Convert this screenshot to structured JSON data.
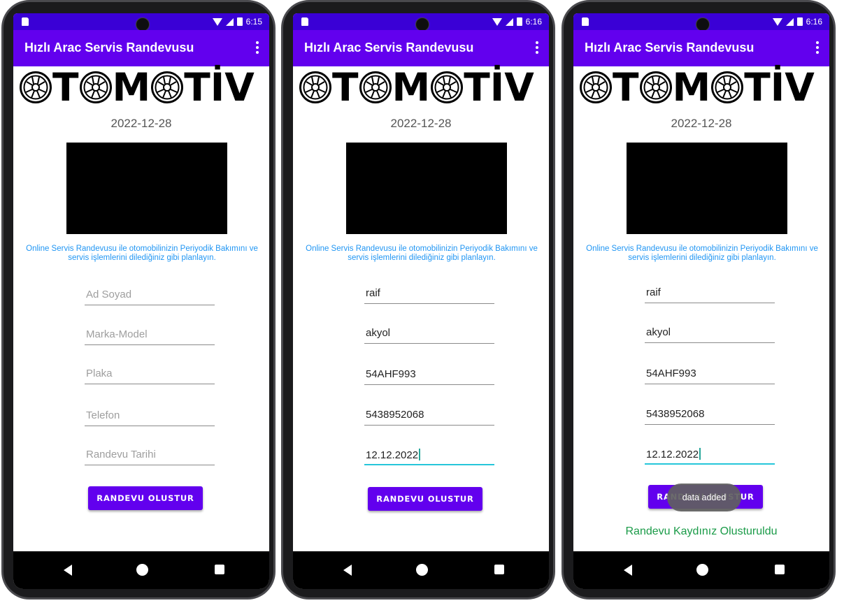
{
  "status_bar": {
    "times": [
      "6:15",
      "6:16",
      "6:16"
    ]
  },
  "app": {
    "title": "Hızlı Arac Servis Randevusu"
  },
  "logo": {
    "letters": [
      "T",
      "M",
      "T",
      "İ",
      "V"
    ]
  },
  "date": "2022-12-28",
  "description": "Online Servis Randevusu ile otomobilinizin Periyodik Bakımını ve servis işlemlerini dilediğiniz gibi planlayın.",
  "form": {
    "placeholders": {
      "name": "Ad Soyad",
      "brand_model": "Marka-Model",
      "plate": "Plaka",
      "phone": "Telefon",
      "appointment_date": "Randevu Tarihi"
    },
    "values": {
      "name": "raif",
      "brand_model": "akyol",
      "plate": "54AHF993",
      "phone": "5438952068",
      "appointment_date": "12.12.2022"
    },
    "submit_label": "RANDEVU OLUSTUR"
  },
  "toast": "data added",
  "success_message": "Randevu Kaydınız Olusturuldu"
}
